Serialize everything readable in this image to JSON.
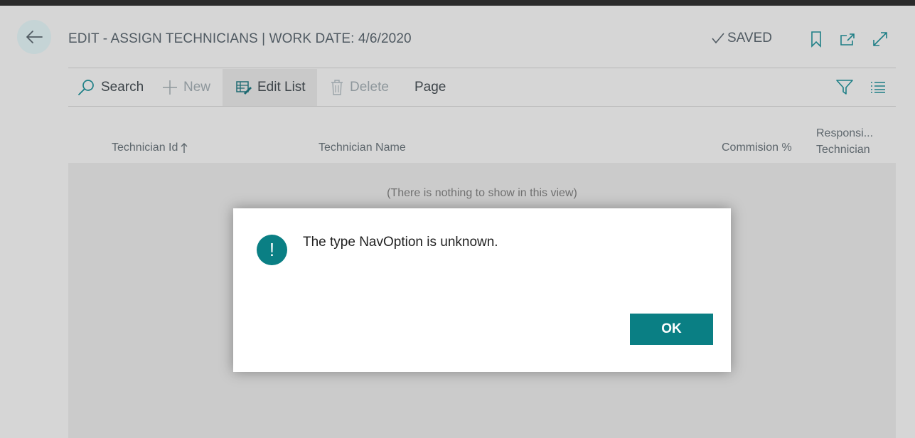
{
  "header": {
    "title": "EDIT - ASSIGN TECHNICIANS | WORK DATE: 4/6/2020",
    "saved_label": "SAVED"
  },
  "toolbar": {
    "search_label": "Search",
    "new_label": "New",
    "edit_list_label": "Edit List",
    "delete_label": "Delete",
    "page_label": "Page"
  },
  "columns": {
    "technician_id": "Technician Id",
    "technician_name": "Technician Name",
    "commission": "Commision %",
    "responsible_line1": "Responsi...",
    "responsible_line2": "Technician"
  },
  "list": {
    "empty_message": "(There is nothing to show in this view)"
  },
  "dialog": {
    "icon_glyph": "!",
    "message": "The type NavOption is unknown.",
    "ok_label": "OK"
  },
  "icons": {
    "back": "back-arrow-icon",
    "saved": "checkmark-icon",
    "bookmark": "bookmark-icon",
    "open_new": "open-in-new-window-icon",
    "expand": "expand-icon",
    "search": "search-icon",
    "new": "plus-icon",
    "edit_list": "edit-list-icon",
    "delete": "trash-icon",
    "filter": "filter-icon",
    "list_view": "list-view-icon",
    "sort": "sort-ascending-icon",
    "alert": "exclamation-icon"
  },
  "colors": {
    "accent": "#0a7f84",
    "page_background": "#d6d6d6",
    "top_bar": "#2b2b2b"
  }
}
